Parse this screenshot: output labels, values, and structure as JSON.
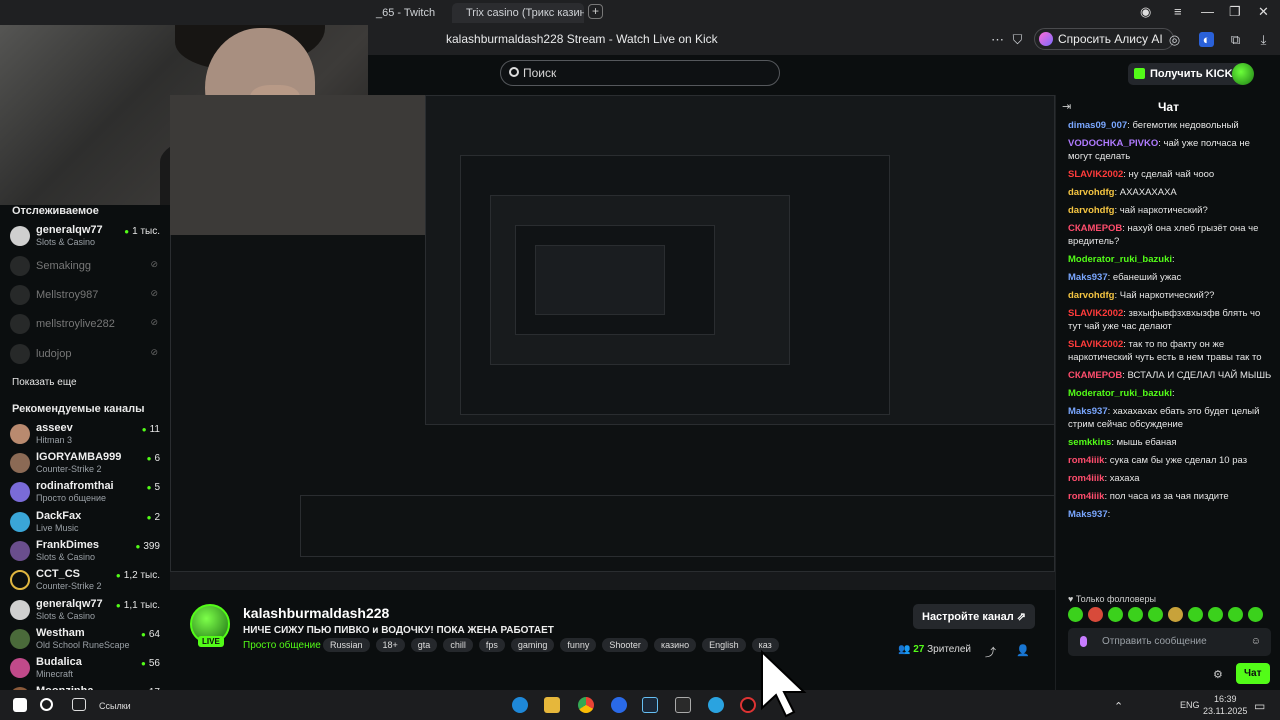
{
  "browser": {
    "tabs": [
      {
        "label": "_65 - Twitch"
      },
      {
        "label": "Trix casino (Трикс казино..."
      }
    ],
    "new_tab": "+",
    "page_title": "kalashburmaldash228 Stream - Watch Live on Kick",
    "alisa_label": "Спросить Алису AI"
  },
  "kick_header": {
    "search_placeholder": "Поиск",
    "get_kicks_label": "Получить KICKs"
  },
  "sidebar": {
    "following_heading": "Отслеживаемое",
    "following": [
      {
        "name": "generalqw77",
        "category": "Slots & Casino",
        "viewers": "1 тыс.",
        "live": true
      },
      {
        "name": "Semakingg",
        "live": false
      },
      {
        "name": "Mellstroy987",
        "live": false
      },
      {
        "name": "mellstroylive282",
        "live": false
      },
      {
        "name": "ludojop",
        "live": false
      }
    ],
    "show_more": "Показать еще",
    "recommended_heading": "Рекомендуемые каналы",
    "recommended": [
      {
        "name": "asseev",
        "category": "Hitman 3",
        "viewers": "11"
      },
      {
        "name": "IGORYAMBA999",
        "category": "Counter-Strike 2",
        "viewers": "6"
      },
      {
        "name": "rodinafromthai",
        "category": "Просто общение",
        "viewers": "5"
      },
      {
        "name": "DackFax",
        "category": "Live Music",
        "viewers": "2"
      },
      {
        "name": "FrankDimes",
        "category": "Slots & Casino",
        "viewers": "399"
      },
      {
        "name": "CCT_CS",
        "category": "Counter-Strike 2",
        "viewers": "1,2 тыс."
      },
      {
        "name": "generalqw77",
        "category": "Slots & Casino",
        "viewers": "1,1 тыс."
      },
      {
        "name": "Westham",
        "category": "Old School RuneScape",
        "viewers": "64"
      },
      {
        "name": "Budalica",
        "category": "Minecraft",
        "viewers": "56"
      },
      {
        "name": "Moonzinha",
        "category": "",
        "viewers": "17"
      }
    ]
  },
  "stream": {
    "channel": "kalashburmaldash228",
    "live_badge": "LIVE",
    "title": "НИЧЕ СИЖУ ПЬЮ ПИВКО и ВОДОЧКУ! ПОКА ЖЕНА РАБОТАЕТ",
    "category": "Просто общение",
    "tags": [
      "Russian",
      "18+",
      "gta",
      "chill",
      "fps",
      "gaming",
      "funny",
      "Shooter",
      "казино",
      "English",
      "каз"
    ],
    "setup_button": "Настройте канал",
    "viewers_count": "27",
    "viewers_label": "Зрителей"
  },
  "chat": {
    "heading": "Чат",
    "messages": [
      {
        "user": "dimas09_007",
        "color": "#7aa7ff",
        "text": "бегемотик недовольный"
      },
      {
        "user": "VODOCHKA_PIVKO",
        "color": "#b07bff",
        "text": "чай уже полчаса не могут сделать"
      },
      {
        "user": "SLAVIK2002",
        "color": "#ff3b3b",
        "text": "ну сделай чай чооо"
      },
      {
        "user": "darvohdfg",
        "color": "#f5c542",
        "text": "АХАХАХАХА"
      },
      {
        "user": "darvohdfg",
        "color": "#f5c542",
        "text": "чай наркотический?"
      },
      {
        "user": "СКАМЕРОВ",
        "color": "#ff4d6d",
        "text": "нахуй она хлеб грызёт она че вредитель?"
      },
      {
        "user": "Moderator_ruki_bazuki",
        "color": "#53fc18",
        "text": ""
      },
      {
        "user": "Maks937",
        "color": "#7aa7ff",
        "text": "ебанеший ужас"
      },
      {
        "user": "darvohdfg",
        "color": "#f5c542",
        "text": "Чай наркотический??"
      },
      {
        "user": "SLAVIK2002",
        "color": "#ff3b3b",
        "text": "звхыфывфзхвхызфв блять чо тут чай уже час делают"
      },
      {
        "user": "SLAVIK2002",
        "color": "#ff3b3b",
        "text": "так то по факту он же наркотический чуть есть в нем травы так то"
      },
      {
        "user": "СКАМЕРОВ",
        "color": "#ff4d6d",
        "text": "ВСТАЛА И СДЕЛАЛ ЧАЙ МЫШЬ"
      },
      {
        "user": "Moderator_ruki_bazuki",
        "color": "#53fc18",
        "text": ""
      },
      {
        "user": "Maks937",
        "color": "#7aa7ff",
        "text": "хахахахах ебать это будет целый стрим сейчас обсуждение"
      },
      {
        "user": "semkkins",
        "color": "#53fc18",
        "text": "мышь ебаная"
      },
      {
        "user": "rom4iiik",
        "color": "#ff4d6d",
        "text": "сука сам бы уже сделал 10 раз"
      },
      {
        "user": "rom4iiik",
        "color": "#ff4d6d",
        "text": "хахаха"
      },
      {
        "user": "rom4iiik",
        "color": "#ff4d6d",
        "text": "пол часа из за чая пиздите"
      },
      {
        "user": "Maks937",
        "color": "#7aa7ff",
        "text": ""
      }
    ],
    "followers_only": "Только фолловеры",
    "input_placeholder": "Отправить сообщение",
    "send_button": "Чат"
  },
  "taskbar": {
    "links_label": "Ссылки",
    "lang": "ENG",
    "time": "16:39",
    "date": "23.11.2025"
  },
  "colors": {
    "accent": "#53fc18",
    "background": "#0b0e0f"
  }
}
